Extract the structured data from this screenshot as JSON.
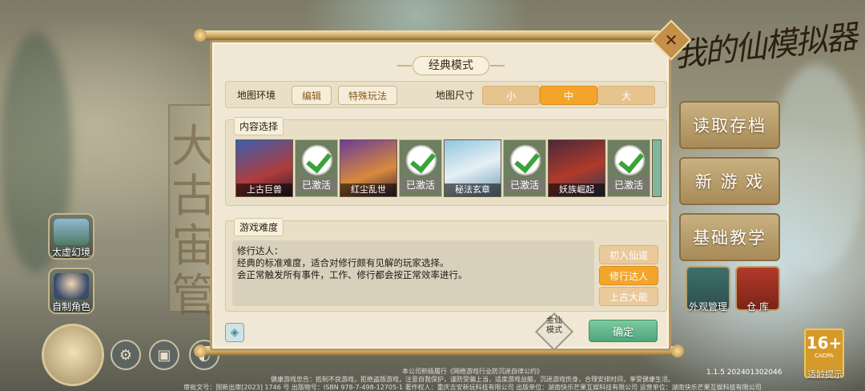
{
  "background": {
    "stele_chars": [
      "大",
      "古",
      "宙",
      "管"
    ],
    "left_tiles": [
      {
        "label": "太虚幻境",
        "icon": "mountain-icon"
      },
      {
        "label": "自制角色",
        "icon": "character-icon"
      }
    ],
    "bottom_icons": [
      "gear-icon",
      "image-icon",
      "globe-icon",
      "mail-icon",
      "bell-icon"
    ],
    "right_menu": [
      "读取存档",
      "新 游 戏",
      "基础教学"
    ],
    "right_tiles": [
      {
        "label": "外观管理",
        "icon": "mask-icon"
      },
      {
        "label": "仓  库",
        "icon": "storehouse-icon"
      }
    ],
    "logo": "我的仙模拟器",
    "age_badge": {
      "big": "16+",
      "small": "CADPA",
      "label": "适龄提示"
    },
    "version": "1.1.5 202401302046",
    "footer": [
      "本公司积极履行《网络游戏行业防沉迷自律公约》",
      "健康游戏忠告：抵制不良游戏，拒绝盗版游戏，注意自我保护，谨防受骗上当，适度游戏益脑，沉迷游戏伤身，合理安排时间，享受健康生活。",
      "审批文号：国新出审[2023] 1746 号  出版物号：ISBN 978-7-498-12705-1  著作权人：重庆吉安新玩科技有限公司  出版单位：湖南快乐芒果互娱科技有限公司  运营单位：湖南快乐芒果互娱科技有限公司"
    ]
  },
  "dialog": {
    "title": "经典模式",
    "map_env_label": "地图环境",
    "edit_label": "编辑",
    "special_label": "特殊玩法",
    "map_size_label": "地图尺寸",
    "sizes": [
      "小",
      "中",
      "大"
    ],
    "selected_size": "中",
    "content_title": "内容选择",
    "contents": [
      {
        "name": "上古巨兽",
        "status": "已激活"
      },
      {
        "name": "红尘乱世",
        "status": "已激活"
      },
      {
        "name": "秘法玄章",
        "status": "已激活"
      },
      {
        "name": "妖族崛起",
        "status": "已激活"
      }
    ],
    "difficulty_title": "游戏难度",
    "difficulty_desc": {
      "line1": "修行达人：",
      "line2": "经典的标准难度，适合对修行颇有见解的玩家选择。",
      "line3": "会正常触发所有事件，工作、修行都会按正常效率进行。"
    },
    "difficulties": [
      "初入仙道",
      "修行达人",
      "上古大能"
    ],
    "selected_difficulty": "修行达人",
    "seal_text": "金仙\n模式",
    "confirm_label": "确定",
    "colors": {
      "accent": "#f2a52a",
      "confirm": "#4ea57a",
      "panel": "#f0e8d4"
    }
  }
}
